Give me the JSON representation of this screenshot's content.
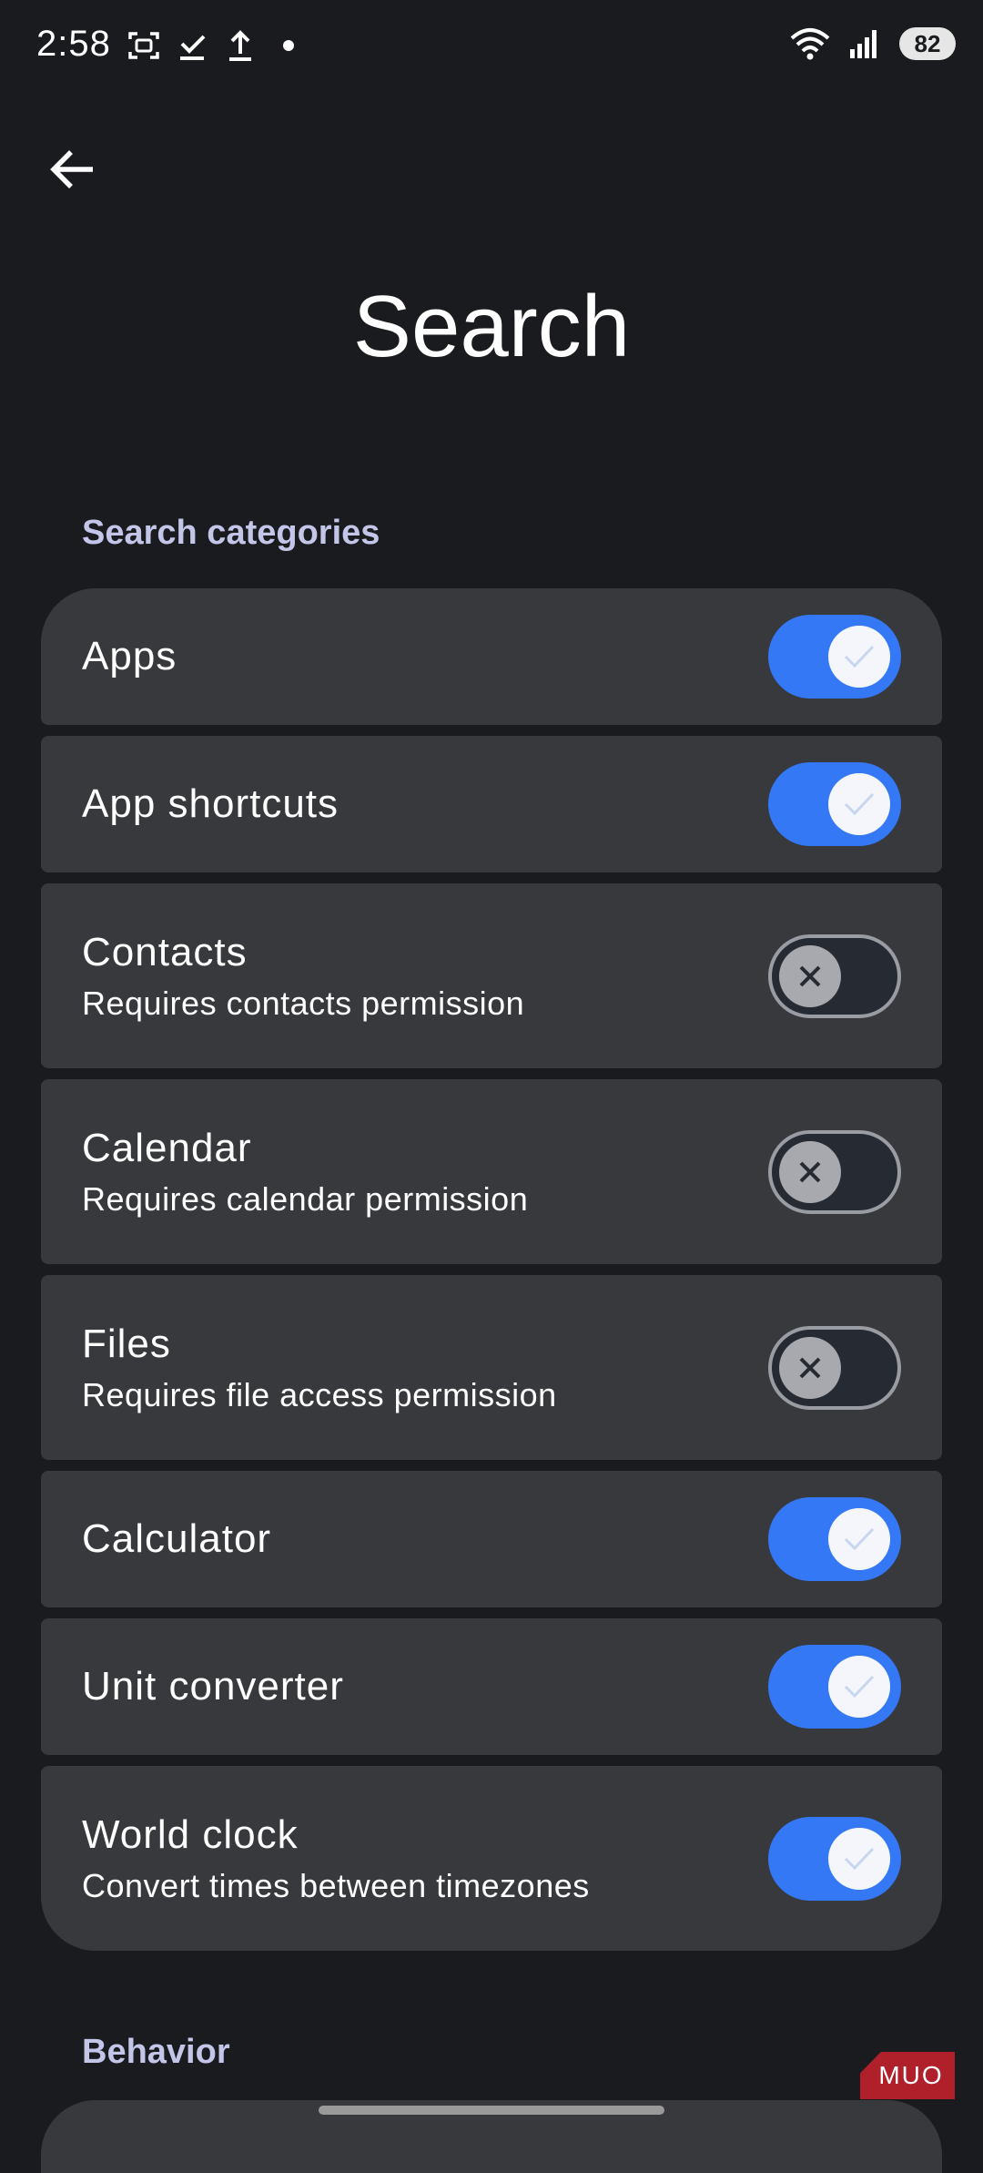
{
  "status_bar": {
    "time": "2:58",
    "battery": "82",
    "left_icons": [
      "screenshot-icon",
      "download-done-icon",
      "upload-icon",
      "dot-icon"
    ],
    "right_icons": [
      "wifi-icon",
      "signal-icon"
    ]
  },
  "header": {
    "back_icon": "arrow-left-icon",
    "title": "Search"
  },
  "sections": [
    {
      "title": "Search categories",
      "items": [
        {
          "title": "Apps",
          "subtitle": "",
          "enabled": true
        },
        {
          "title": "App shortcuts",
          "subtitle": "",
          "enabled": true
        },
        {
          "title": "Contacts",
          "subtitle": "Requires contacts permission",
          "enabled": false
        },
        {
          "title": "Calendar",
          "subtitle": "Requires calendar permission",
          "enabled": false
        },
        {
          "title": "Files",
          "subtitle": "Requires file access permission",
          "enabled": false
        },
        {
          "title": "Calculator",
          "subtitle": "",
          "enabled": true
        },
        {
          "title": "Unit converter",
          "subtitle": "",
          "enabled": true
        },
        {
          "title": "World clock",
          "subtitle": "Convert times between timezones",
          "enabled": true
        }
      ]
    },
    {
      "title": "Behavior",
      "items": []
    }
  ],
  "watermark": "MUO",
  "colors": {
    "background": "#1a1b1e",
    "card": "#38393d",
    "accent": "#3478f6",
    "section_header": "#c3c6e8"
  }
}
